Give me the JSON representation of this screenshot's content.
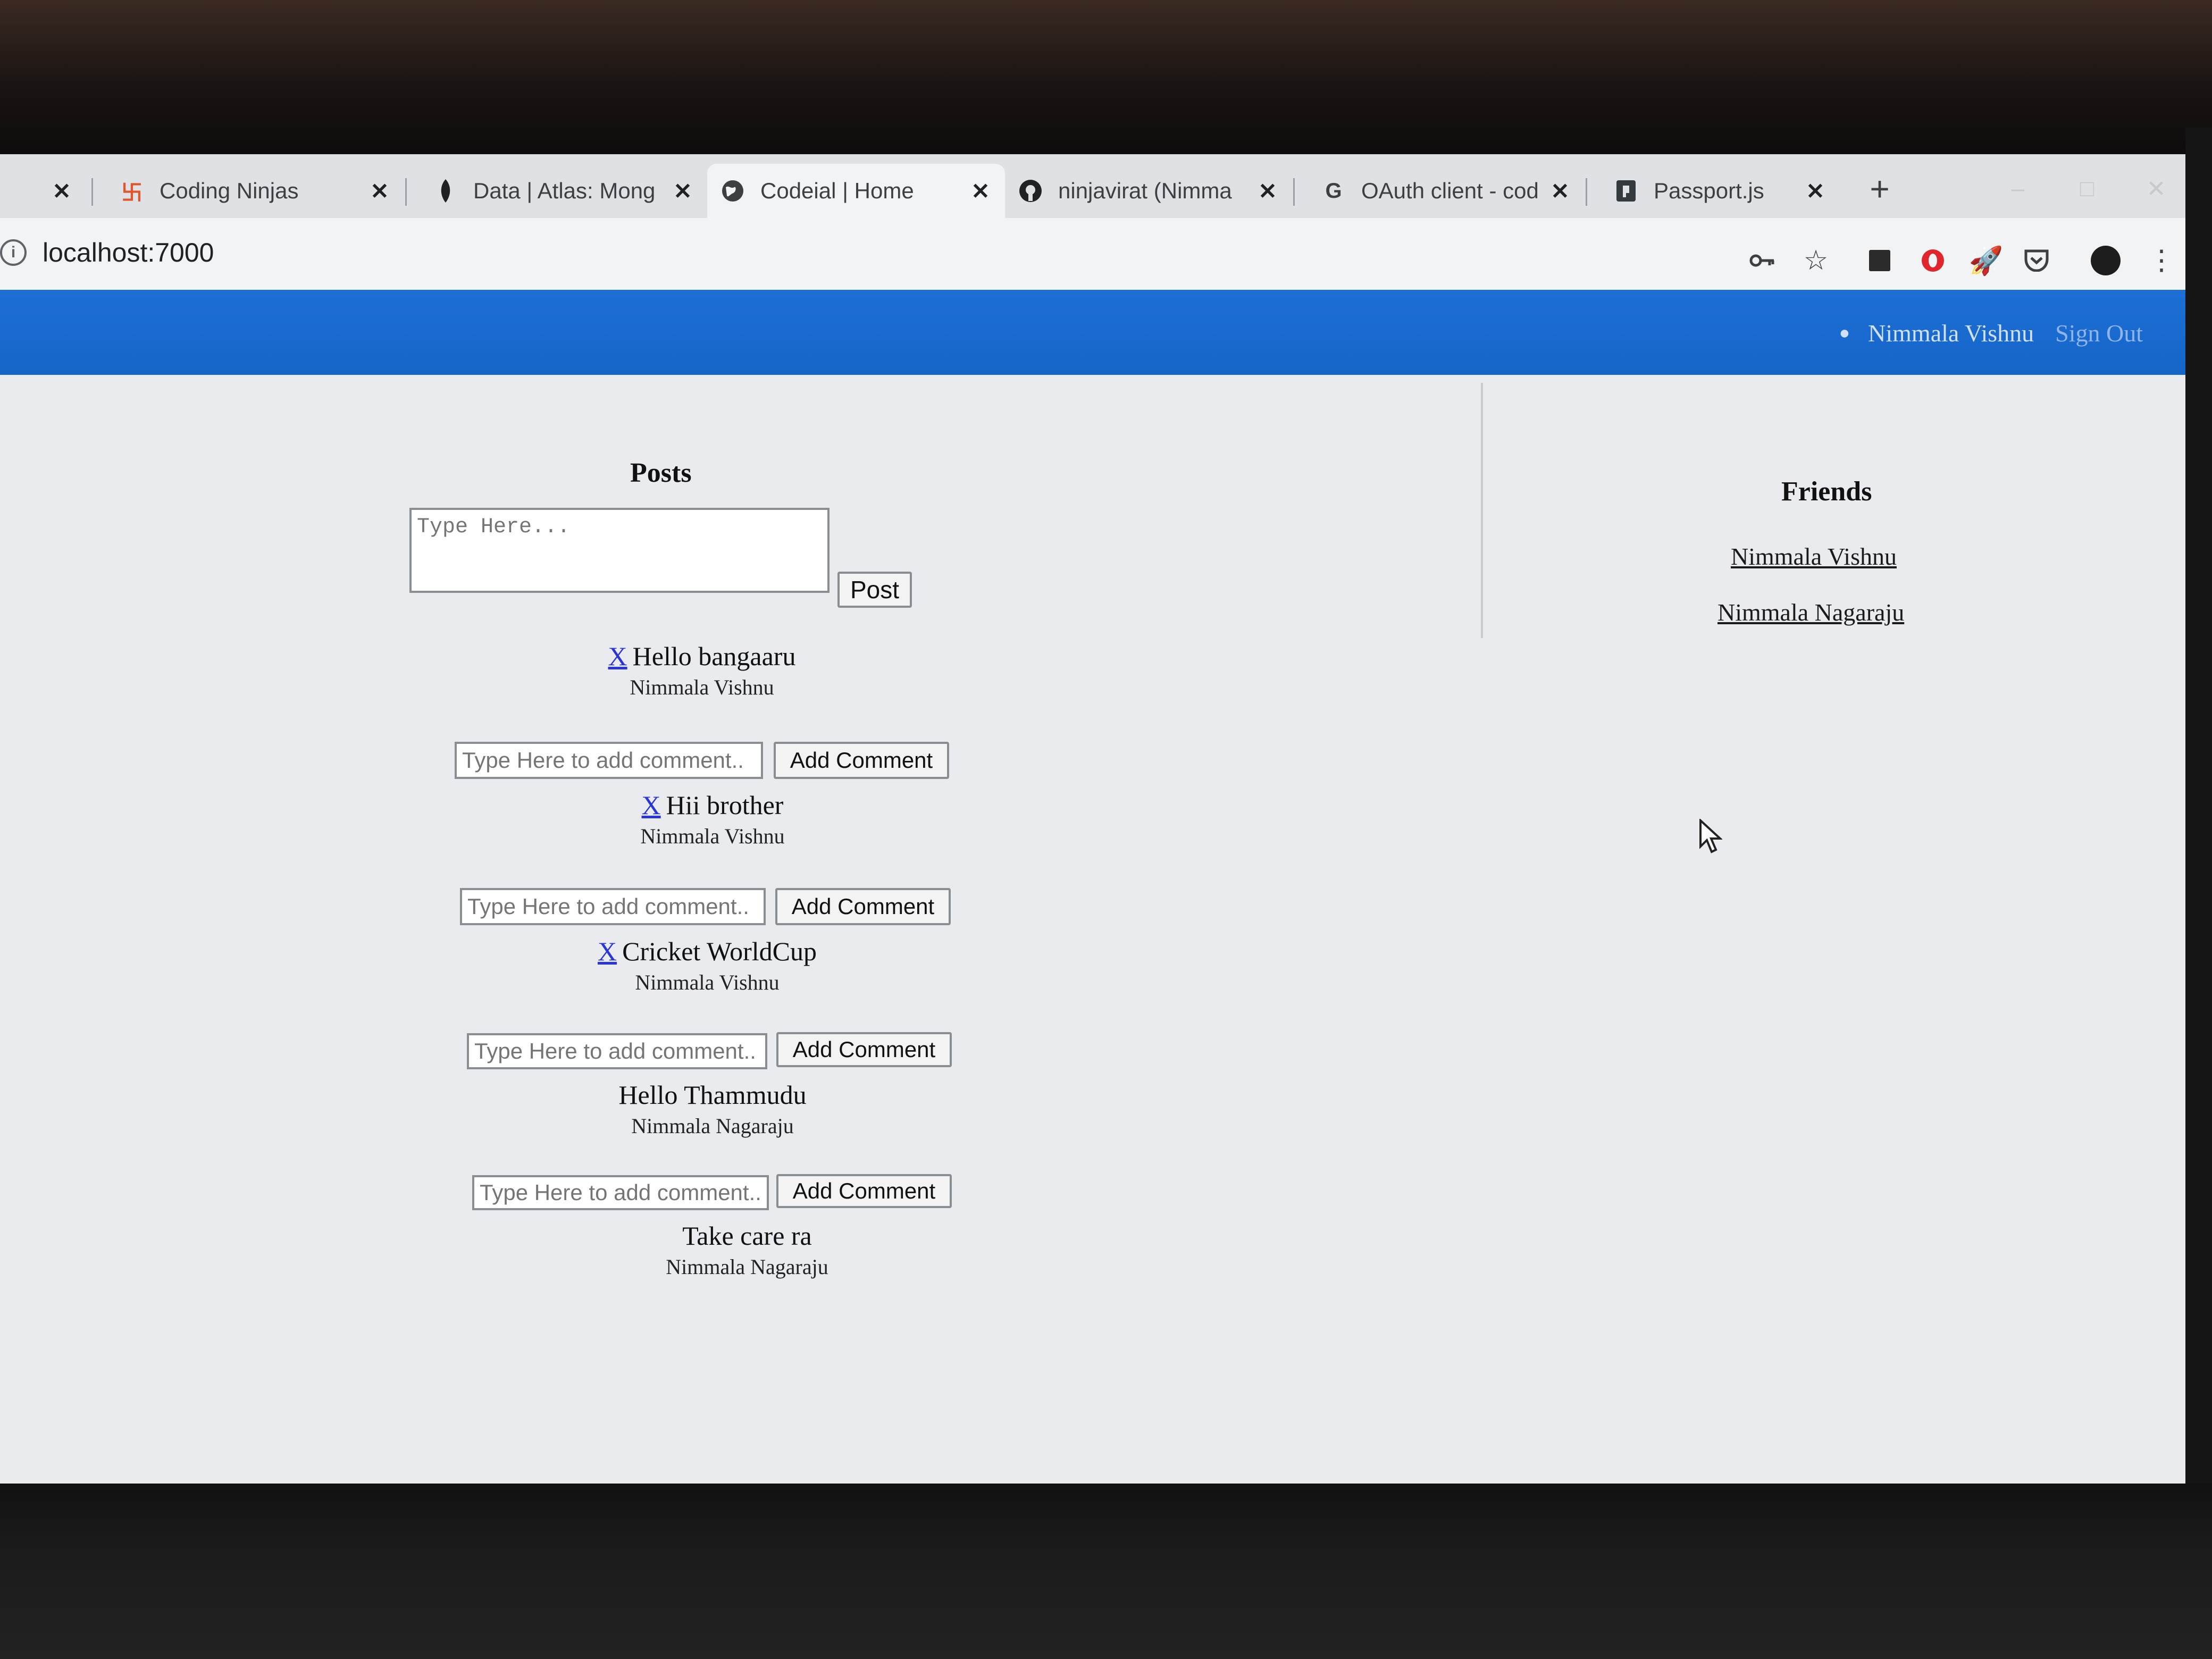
{
  "browser": {
    "tabs": [
      {
        "label": "Coding Ninjas",
        "favicon": "coding-ninjas-icon",
        "active": false
      },
      {
        "label": "Data | Atlas: Mong",
        "favicon": "mongodb-leaf-icon",
        "active": false
      },
      {
        "label": "Codeial | Home",
        "favicon": "globe-icon",
        "active": true
      },
      {
        "label": "ninjavirat (Nimma",
        "favicon": "github-icon",
        "active": false
      },
      {
        "label": "OAuth client - cod",
        "favicon": "google-g-icon",
        "active": false
      },
      {
        "label": "Passport.js",
        "favicon": "passport-icon",
        "active": false
      }
    ],
    "close_glyph": "✕",
    "new_tab_glyph": "+",
    "url": "localhost:7000"
  },
  "header": {
    "user_name": "Nimmala Vishnu",
    "sign_out": "Sign Out",
    "color": "#1b6bd1"
  },
  "posts_section": {
    "heading": "Posts",
    "textarea_placeholder": "Type Here...",
    "post_button": "Post",
    "delete_glyph": "X",
    "comment_placeholder": "Type Here to add comment..",
    "comment_button": "Add Comment",
    "posts": [
      {
        "content": "Hello bangaaru",
        "author": "Nimmala Vishnu",
        "deletable": true
      },
      {
        "content": "Hii brother",
        "author": "Nimmala Vishnu",
        "deletable": true
      },
      {
        "content": "Cricket WorldCup",
        "author": "Nimmala Vishnu",
        "deletable": true
      },
      {
        "content": "Hello Thammudu",
        "author": "Nimmala Nagaraju",
        "deletable": false
      },
      {
        "content": "Take care ra",
        "author": "Nimmala Nagaraju",
        "deletable": false
      }
    ]
  },
  "friends_section": {
    "heading": "Friends",
    "friends": [
      "Nimmala Vishnu",
      "Nimmala Nagaraju"
    ]
  }
}
